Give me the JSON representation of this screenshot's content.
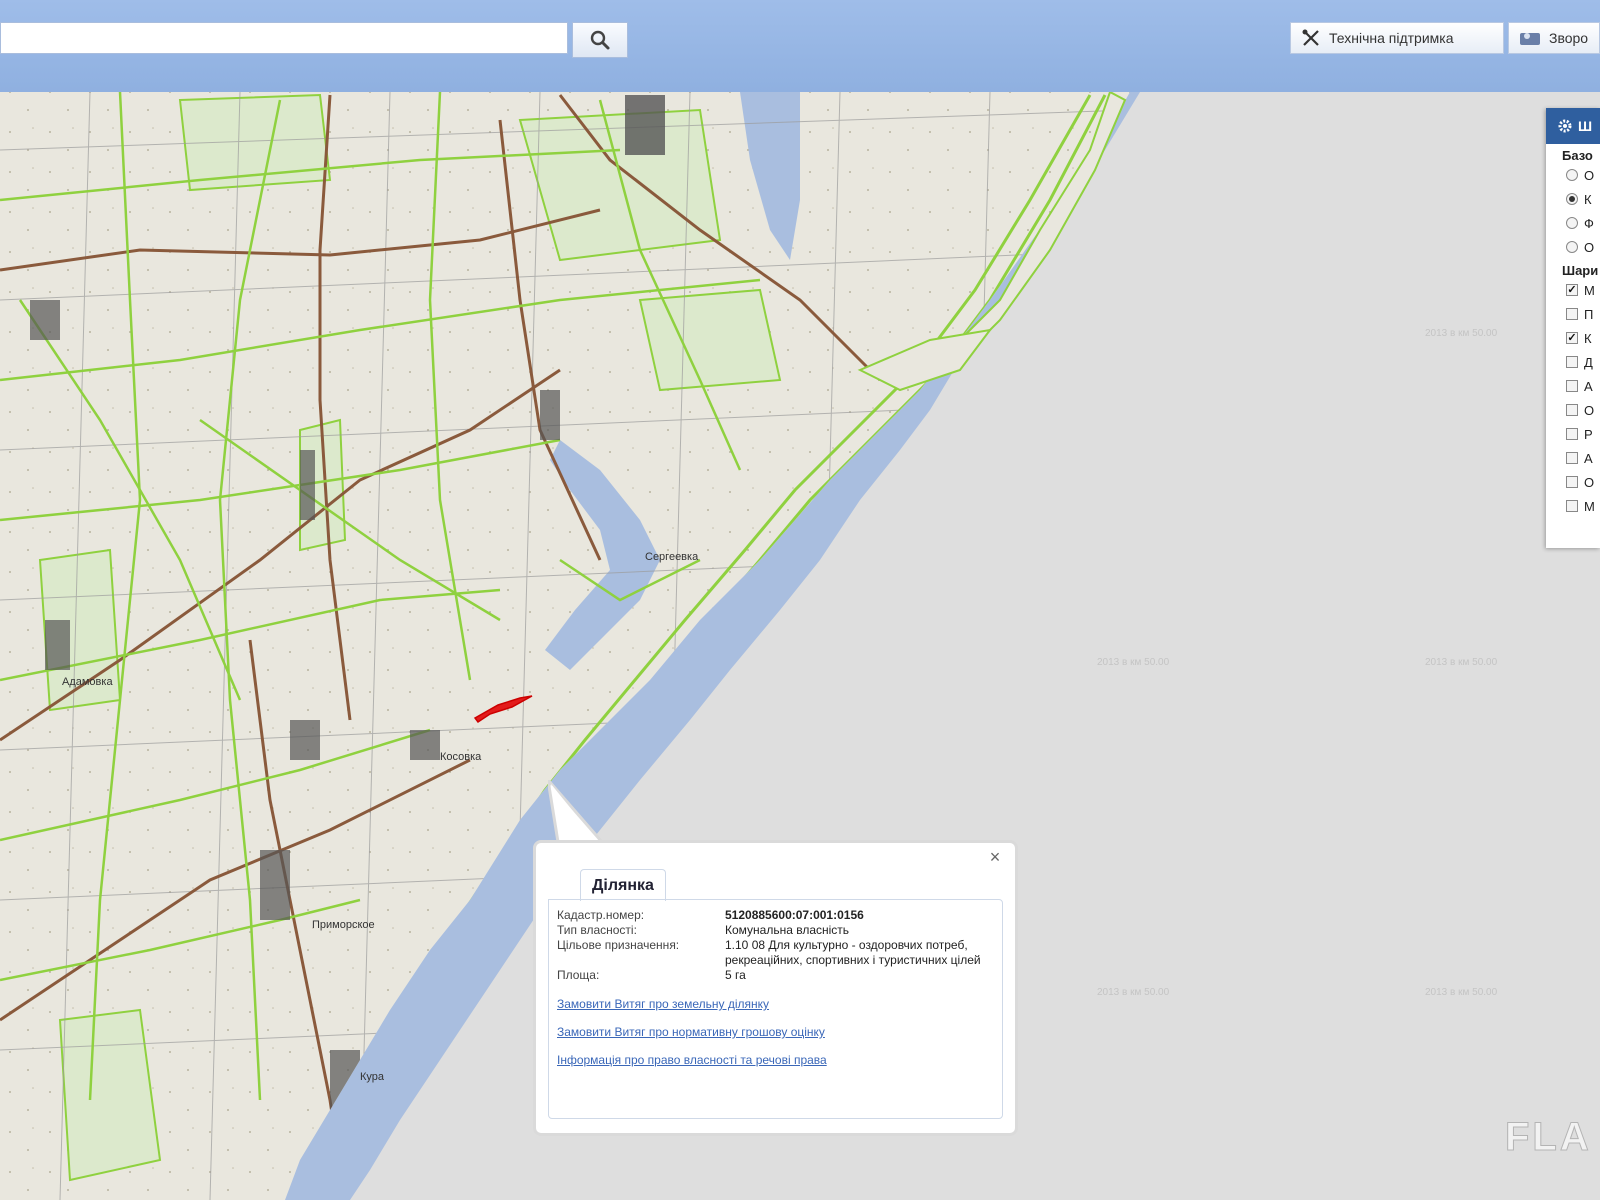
{
  "toolbar": {
    "search_value": "",
    "support_label": "Технічна підтримка",
    "feedback_label": "Зворо"
  },
  "map": {
    "place_labels": [
      "Сергеевка",
      "Косовка",
      "Приморское",
      "Кура",
      "Адамовка"
    ],
    "watermark": "2013 в км 50.00",
    "brand": "FLA"
  },
  "layers_panel": {
    "title": "Ш",
    "base_section": "Базо",
    "base_items": [
      {
        "label": "О",
        "selected": false
      },
      {
        "label": "К",
        "selected": true
      },
      {
        "label": "Ф",
        "selected": false
      },
      {
        "label": "О",
        "selected": false
      }
    ],
    "layers_section": "Шари",
    "layer_items": [
      {
        "label": "М",
        "checked": true
      },
      {
        "label": "П",
        "checked": false
      },
      {
        "label": "К",
        "checked": true
      },
      {
        "label": "Д",
        "checked": false
      },
      {
        "label": "А",
        "checked": false
      },
      {
        "label": "О",
        "checked": false
      },
      {
        "label": "Р",
        "checked": false
      },
      {
        "label": "А",
        "checked": false
      },
      {
        "label": "О",
        "checked": false
      },
      {
        "label": "М",
        "checked": false
      }
    ]
  },
  "popup": {
    "tab_title": "Ділянка",
    "fields": [
      {
        "label": "Кадастр.номер:",
        "value": "5120885600:07:001:0156",
        "bold": true
      },
      {
        "label": "Тип власності:",
        "value": "Комунальна власність",
        "bold": false
      },
      {
        "label": "Цільове призначення:",
        "value": "1.10 08 Для культурно - оздоровчих потреб, рекреаційних, спортивних і туристичних цілей",
        "bold": false
      },
      {
        "label": "Площа:",
        "value": "5 га",
        "bold": false
      }
    ],
    "links": [
      "Замовити Витяг про земельну ділянку",
      "Замовити Витяг про нормативну грошову оцінку",
      "Інформація про право власності та речові права"
    ]
  },
  "colors": {
    "sea": "#a9bedf",
    "water_band": "#93b0dc",
    "parcel_outline": "#8fd13f",
    "selected_parcel": "#e31b1b",
    "header": "#9fbde9"
  }
}
